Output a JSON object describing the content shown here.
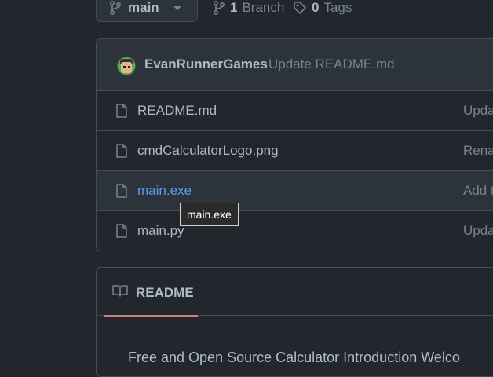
{
  "branch": {
    "name": "main"
  },
  "meta": {
    "branch_count": "1",
    "branch_label": "Branch",
    "tag_count": "0",
    "tag_label": "Tags"
  },
  "commit": {
    "author": "EvanRunnerGames",
    "message": "Update README.md"
  },
  "files": [
    {
      "name": "README.md",
      "commit": "Upda"
    },
    {
      "name": "cmdCalculatorLogo.png",
      "commit": "Rena"
    },
    {
      "name": "main.exe",
      "commit": "Add t"
    },
    {
      "name": "main.py",
      "commit": "Upda"
    }
  ],
  "tooltip": {
    "text": "main.exe"
  },
  "readme": {
    "tab_label": "README",
    "body_text": "Free and Open Source Calculator Introduction Welco"
  },
  "colors": {
    "background": "#22272e",
    "link": "#539bf5",
    "tab_underline": "#ec775c"
  },
  "icons": {
    "branch": "git-branch-icon",
    "tag": "tag-icon",
    "file": "file-icon",
    "book": "book-icon"
  }
}
